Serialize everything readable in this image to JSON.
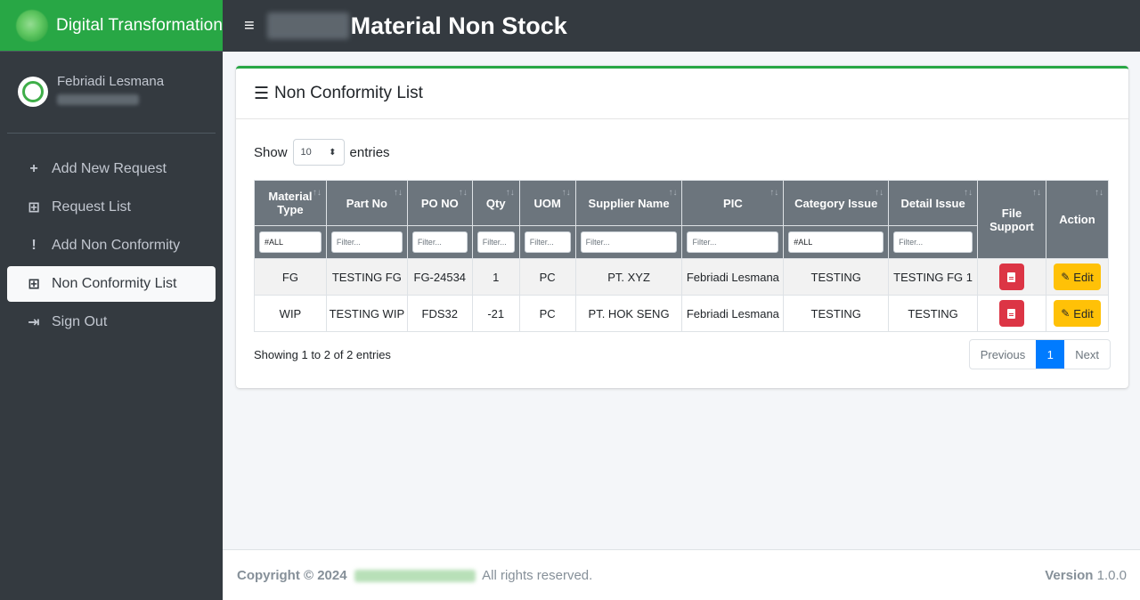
{
  "brand": {
    "title": "Digital Transformation"
  },
  "user": {
    "name": "Febriadi Lesmana"
  },
  "sidebar": {
    "items": [
      {
        "icon": "+",
        "label": "Add New Request"
      },
      {
        "icon": "⊞",
        "label": "Request List"
      },
      {
        "icon": "!",
        "label": "Add Non Conformity"
      },
      {
        "icon": "⊞",
        "label": "Non Conformity List"
      },
      {
        "icon": "⇥",
        "label": "Sign Out"
      }
    ]
  },
  "header": {
    "menu_icon": "≡",
    "title": "Material Non Stock"
  },
  "card": {
    "title": "Non Conformity List",
    "show_label": "Show",
    "entries_label": "entries",
    "page_length": "10",
    "info": "Showing 1 to 2 of 2 entries"
  },
  "table": {
    "headers": [
      "Material Type",
      "Part No",
      "PO NO",
      "Qty",
      "UOM",
      "Supplier Name",
      "PIC",
      "Category Issue",
      "Detail Issue",
      "File Support",
      "Action"
    ],
    "filters": {
      "material_type": "#ALL",
      "category_issue": "#ALL",
      "placeholder": "Filter..."
    },
    "rows": [
      {
        "material_type": "FG",
        "part_no": "TESTING FG",
        "po_no": "FG-24534",
        "qty": "1",
        "uom": "PC",
        "supplier": "PT. XYZ",
        "pic": "Febriadi Lesmana",
        "category": "TESTING",
        "detail": "TESTING FG 1",
        "action": "Edit"
      },
      {
        "material_type": "WIP",
        "part_no": "TESTING WIP",
        "po_no": "FDS32",
        "qty": "-21",
        "uom": "PC",
        "supplier": "PT. HOK SENG",
        "pic": "Febriadi Lesmana",
        "category": "TESTING",
        "detail": "TESTING",
        "action": "Edit"
      }
    ]
  },
  "pagination": {
    "previous": "Previous",
    "current": "1",
    "next": "Next"
  },
  "footer": {
    "copyright": "Copyright © 2024",
    "rights": "All rights reserved.",
    "version_label": "Version",
    "version": "1.0.0"
  },
  "colors": {
    "brand": "#28a745",
    "sidebar": "#343a40",
    "primary": "#007bff",
    "danger": "#dc3545",
    "warning": "#ffc107"
  }
}
